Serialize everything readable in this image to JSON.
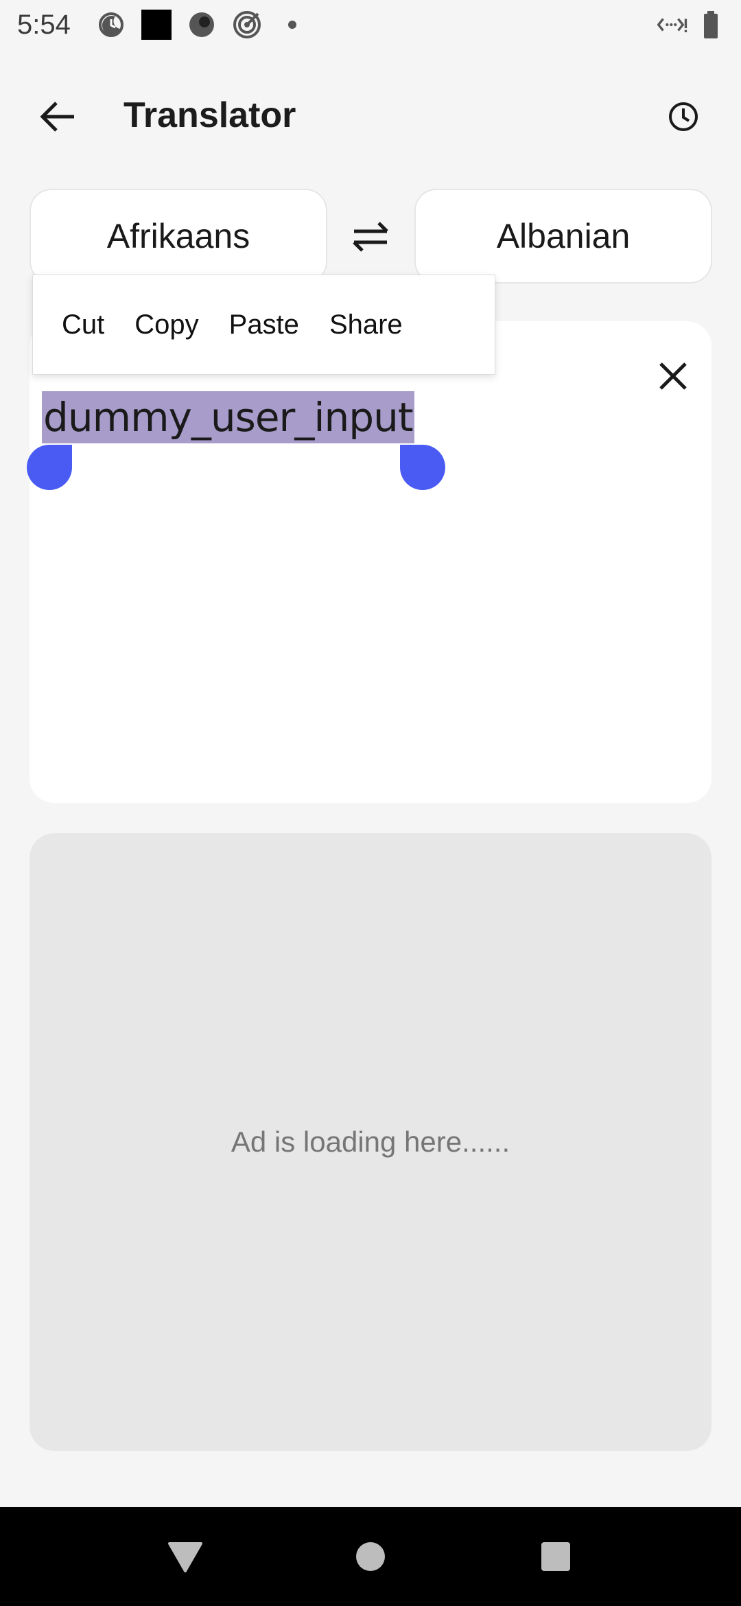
{
  "status_bar": {
    "time": "5:54",
    "left_icons": [
      "do-not-disturb-icon",
      "square-app-icon",
      "circle-app-icon",
      "target-icon",
      "dot-icon"
    ],
    "right_icons": [
      "data-saver-icon",
      "battery-icon"
    ]
  },
  "app_bar": {
    "title": "Translator",
    "back_icon": "arrow-left-icon",
    "history_icon": "clock-icon"
  },
  "languages": {
    "source": "Afrikaans",
    "target": "Albanian",
    "swap_icon": "swap-arrows-icon"
  },
  "context_menu": {
    "items": [
      "Cut",
      "Copy",
      "Paste",
      "Share"
    ]
  },
  "input": {
    "value": "dummy_user_input",
    "clear_icon": "close-icon"
  },
  "ad": {
    "text": "Ad is loading here......"
  },
  "nav_bar": {
    "icons": [
      "nav-back-icon",
      "nav-home-icon",
      "nav-recent-icon"
    ]
  },
  "colors": {
    "selection": "#a89ccb",
    "handle": "#4a5bf4",
    "background": "#f5f5f5",
    "ad_background": "#e7e7e7"
  }
}
